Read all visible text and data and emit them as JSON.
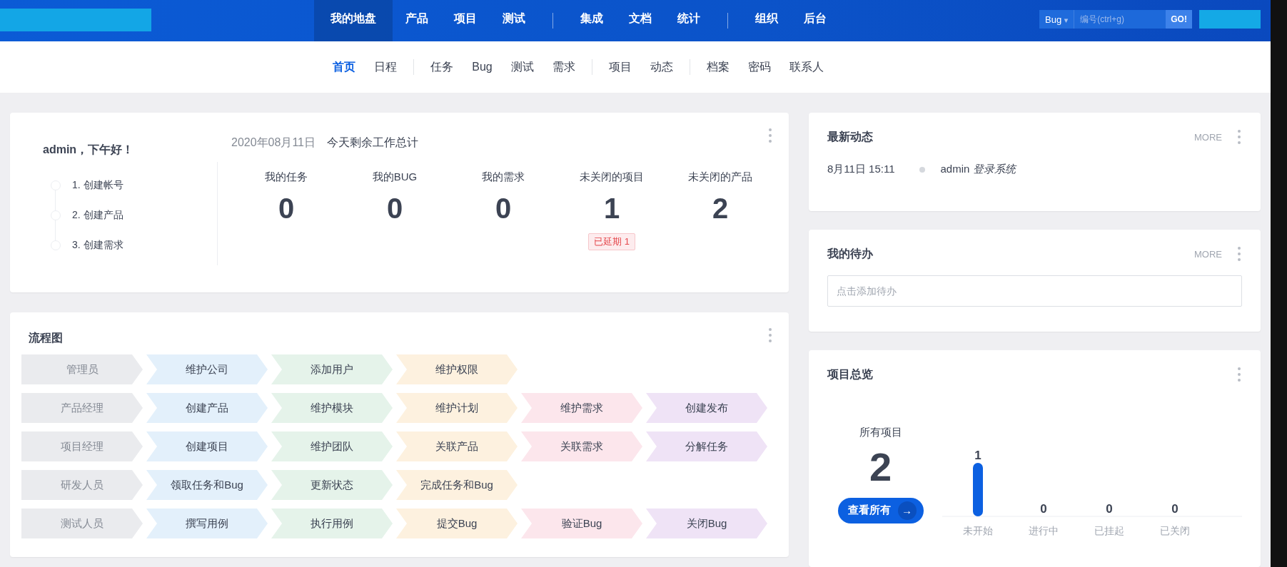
{
  "top_nav": {
    "groups": [
      [
        {
          "label": "我的地盘",
          "selected": true
        },
        {
          "label": "产品",
          "selected": false
        },
        {
          "label": "项目",
          "selected": false
        },
        {
          "label": "测试",
          "selected": false
        }
      ],
      [
        {
          "label": "集成",
          "selected": false
        },
        {
          "label": "文档",
          "selected": false
        },
        {
          "label": "统计",
          "selected": false
        }
      ],
      [
        {
          "label": "组织",
          "selected": false
        },
        {
          "label": "后台",
          "selected": false
        }
      ]
    ],
    "search": {
      "type": "Bug",
      "caret": "▾",
      "placeholder": "编号(ctrl+g)",
      "button": "GO!"
    }
  },
  "sub_nav": {
    "groups": [
      [
        {
          "label": "首页",
          "selected": true
        },
        {
          "label": "日程",
          "selected": false
        }
      ],
      [
        {
          "label": "任务",
          "selected": false
        },
        {
          "label": "Bug",
          "selected": false
        },
        {
          "label": "测试",
          "selected": false
        },
        {
          "label": "需求",
          "selected": false
        }
      ],
      [
        {
          "label": "项目",
          "selected": false
        },
        {
          "label": "动态",
          "selected": false
        }
      ],
      [
        {
          "label": "档案",
          "selected": false
        },
        {
          "label": "密码",
          "selected": false
        },
        {
          "label": "联系人",
          "selected": false
        }
      ]
    ]
  },
  "welcome": {
    "greeting": "admin，下午好！",
    "steps": [
      "1. 创建帐号",
      "2. 创建产品",
      "3. 创建需求"
    ],
    "date": "2020年08月11日",
    "title": "今天剩余工作总计",
    "stats": [
      {
        "label": "我的任务",
        "value": "0"
      },
      {
        "label": "我的BUG",
        "value": "0"
      },
      {
        "label": "我的需求",
        "value": "0"
      },
      {
        "label": "未关闭的项目",
        "value": "1",
        "badge": "已延期 1"
      },
      {
        "label": "未关闭的产品",
        "value": "2"
      }
    ]
  },
  "flow": {
    "title": "流程图",
    "rows": [
      {
        "role": "管理员",
        "steps": [
          {
            "label": "维护公司",
            "color": "#e3f0fb"
          },
          {
            "label": "添加用户",
            "color": "#e5f3ea"
          },
          {
            "label": "维护权限",
            "color": "#fdf1df"
          }
        ]
      },
      {
        "role": "产品经理",
        "steps": [
          {
            "label": "创建产品",
            "color": "#e3f0fb"
          },
          {
            "label": "维护模块",
            "color": "#e5f3ea"
          },
          {
            "label": "维护计划",
            "color": "#fdf1df"
          },
          {
            "label": "维护需求",
            "color": "#fce6ec"
          },
          {
            "label": "创建发布",
            "color": "#efe3f6"
          }
        ]
      },
      {
        "role": "项目经理",
        "steps": [
          {
            "label": "创建项目",
            "color": "#e3f0fb"
          },
          {
            "label": "维护团队",
            "color": "#e5f3ea"
          },
          {
            "label": "关联产品",
            "color": "#fdf1df"
          },
          {
            "label": "关联需求",
            "color": "#fce6ec"
          },
          {
            "label": "分解任务",
            "color": "#efe3f6"
          }
        ]
      },
      {
        "role": "研发人员",
        "steps": [
          {
            "label": "领取任务和Bug",
            "color": "#e3f0fb"
          },
          {
            "label": "更新状态",
            "color": "#e5f3ea"
          },
          {
            "label": "完成任务和Bug",
            "color": "#fdf1df"
          }
        ]
      },
      {
        "role": "测试人员",
        "steps": [
          {
            "label": "撰写用例",
            "color": "#e3f0fb"
          },
          {
            "label": "执行用例",
            "color": "#e5f3ea"
          },
          {
            "label": "提交Bug",
            "color": "#fdf1df"
          },
          {
            "label": "验证Bug",
            "color": "#fce6ec"
          },
          {
            "label": "关闭Bug",
            "color": "#efe3f6"
          }
        ]
      }
    ]
  },
  "dynamics": {
    "title": "最新动态",
    "more": "MORE",
    "items": [
      {
        "time": "8月11日 15:11",
        "actor": "admin",
        "action": "登录系统"
      }
    ]
  },
  "todo": {
    "title": "我的待办",
    "more": "MORE",
    "placeholder": "点击添加待办"
  },
  "overview": {
    "title": "项目总览",
    "total_label": "所有项目",
    "total": "2",
    "button": "查看所有",
    "button_icon": "→",
    "chart_data": {
      "type": "bar",
      "categories": [
        "未开始",
        "进行中",
        "已挂起",
        "已关闭"
      ],
      "values": [
        1,
        0,
        0,
        0
      ],
      "data_labels": true
    }
  }
}
